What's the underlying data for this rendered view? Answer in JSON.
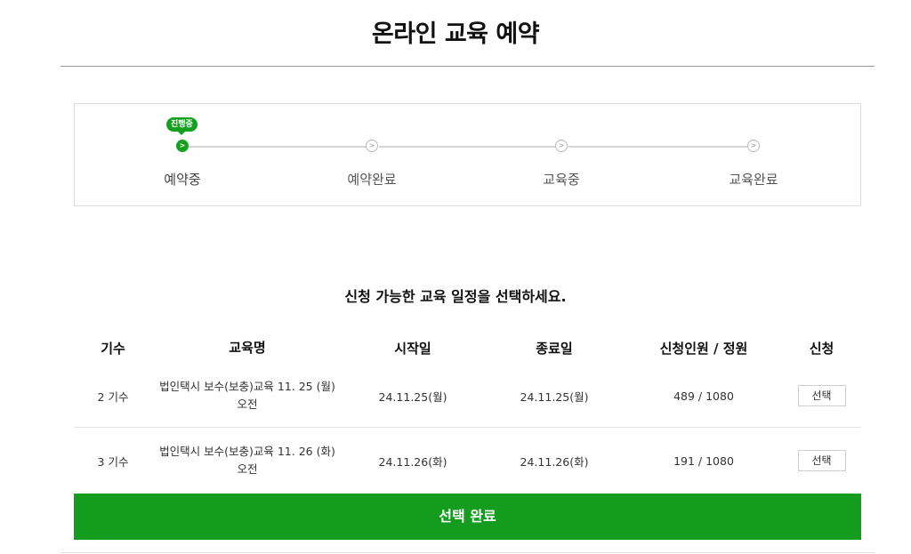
{
  "page": {
    "title": "온라인 교육 예약"
  },
  "steps": {
    "active_badge": "진행중",
    "items": [
      {
        "label": "예약중",
        "state": "active"
      },
      {
        "label": "예약완료",
        "state": "pending"
      },
      {
        "label": "교육중",
        "state": "pending"
      },
      {
        "label": "교육완료",
        "state": "pending"
      }
    ],
    "dot_glyph": ">"
  },
  "instruction": "신청 가능한 교육 일정을 선택하세요.",
  "schedule": {
    "headers": {
      "term": "기수",
      "name": "교육명",
      "start": "시작일",
      "end": "종료일",
      "count": "신청인원 / 정원",
      "apply": "신청"
    },
    "rows": [
      {
        "term": "2 기수",
        "name": "법인택시 보수(보충)교육 11. 25 (월) 오전",
        "start": "24.11.25(월)",
        "end": "24.11.25(월)",
        "count": "489 / 1080",
        "apply_label": "선택"
      },
      {
        "term": "3 기수",
        "name": "법인택시 보수(보충)교육 11. 26 (화) 오전",
        "start": "24.11.26(화)",
        "end": "24.11.26(화)",
        "count": "191 / 1080",
        "apply_label": "선택"
      }
    ]
  },
  "complete_button": "선택 완료",
  "colors": {
    "accent": "#139c1e",
    "border": "#dcdcdc"
  }
}
